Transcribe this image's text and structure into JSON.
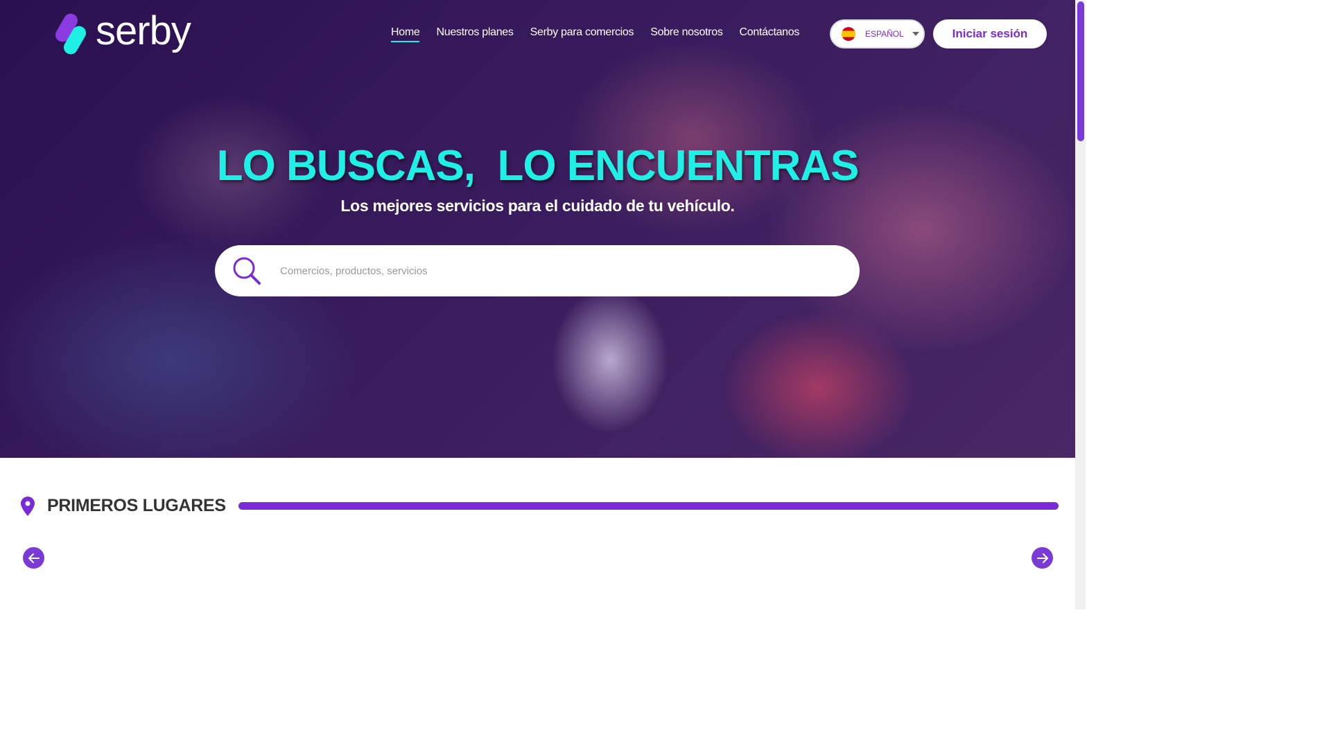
{
  "brand": {
    "name": "serby"
  },
  "nav": {
    "items": [
      {
        "label": "Home",
        "active": true
      },
      {
        "label": "Nuestros planes"
      },
      {
        "label": "Serby para comercios"
      },
      {
        "label": "Sobre nosotros"
      },
      {
        "label": "Contáctanos"
      }
    ]
  },
  "language": {
    "selected": "ESPAÑOL",
    "icon": "spain-flag-icon"
  },
  "login": {
    "label": "Iniciar sesión"
  },
  "hero": {
    "title": "LO BUSCAS,  LO ENCUENTRAS",
    "subtitle": "Los mejores servicios para el cuidado de tu vehículo."
  },
  "search": {
    "placeholder": "Comercios, productos, servicios",
    "value": ""
  },
  "section": {
    "title": "PRIMEROS LUGARES",
    "icon": "location-pin-icon"
  },
  "colors": {
    "accent": "#7a2ad6",
    "cyan": "#1ff0e6"
  }
}
